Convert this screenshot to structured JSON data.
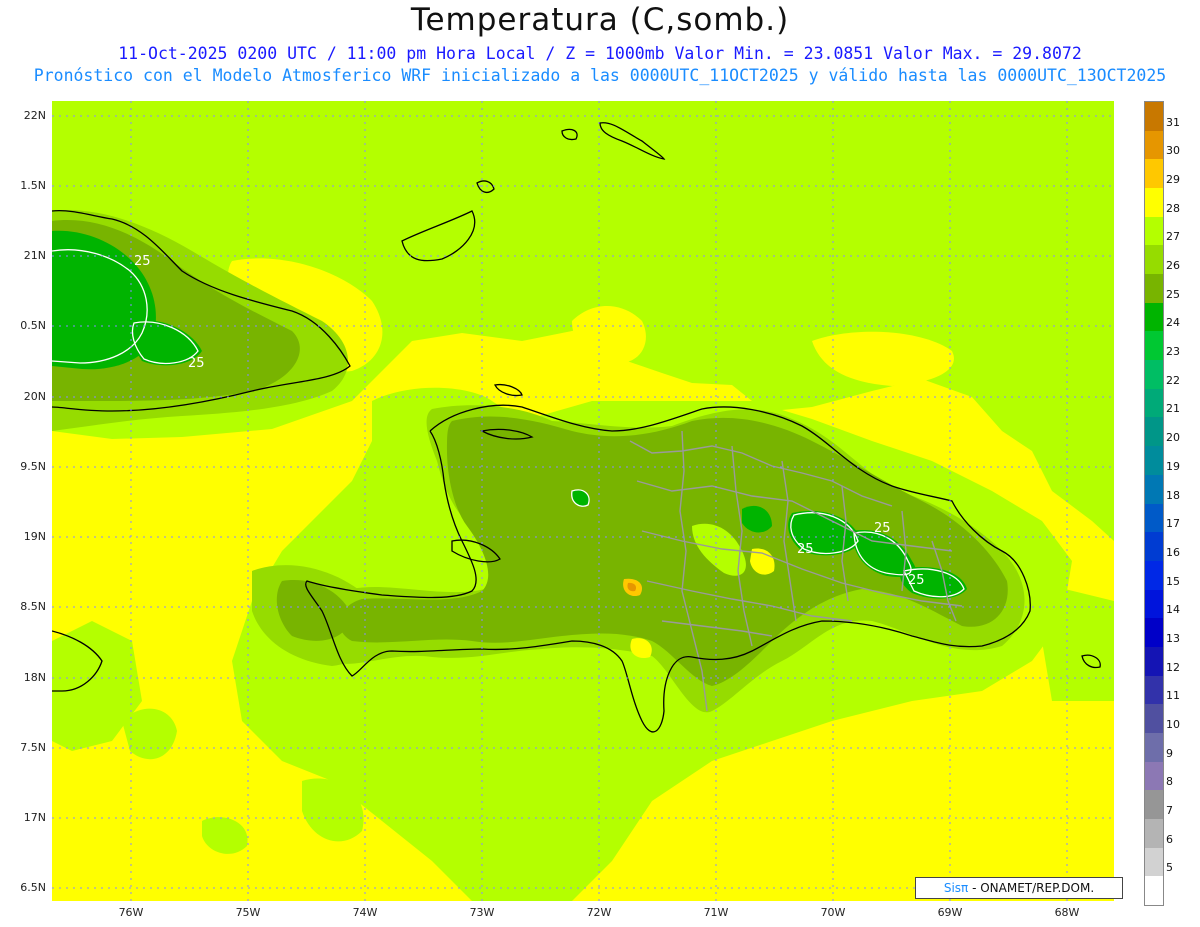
{
  "header": {
    "title": "Temperatura (C,somb.)",
    "line1": "11-Oct-2025 0200 UTC / 11:00 pm Hora Local / Z = 1000mb  Valor Min. = 23.0851  Valor Max. = 29.8072",
    "line2": "Pronóstico con el Modelo Atmosferico WRF inicializado a las 0000UTC_11OCT2025 y válido hasta las  0000UTC_13OCT2025"
  },
  "latitude_labels": [
    "22N",
    "1.5N",
    "21N",
    "0.5N",
    "20N",
    "9.5N",
    "19N",
    "8.5N",
    "18N",
    "7.5N",
    "17N",
    "6.5N"
  ],
  "longitude_labels": [
    "76W",
    "75W",
    "74W",
    "73W",
    "72W",
    "71W",
    "70W",
    "69W",
    "68W"
  ],
  "colorbar": {
    "labels": [
      "31",
      "30",
      "29",
      "28",
      "27",
      "26",
      "25",
      "24",
      "23",
      "22",
      "21",
      "20",
      "19",
      "18",
      "17",
      "16",
      "15",
      "14",
      "13",
      "12",
      "11",
      "10",
      "9",
      "8",
      "7",
      "6",
      "5"
    ],
    "colors": [
      "#c87800",
      "#e69600",
      "#ffc800",
      "#ffff00",
      "#b4ff00",
      "#96dc00",
      "#78b400",
      "#00b400",
      "#00c832",
      "#00be64",
      "#00aa78",
      "#009688",
      "#008c9c",
      "#0078b4",
      "#005ac8",
      "#003cd2",
      "#0028e6",
      "#0014dc",
      "#0000c8",
      "#1414b4",
      "#3232aa",
      "#5050a0",
      "#6e6eaa",
      "#8c78b4",
      "#969696",
      "#b4b4b4",
      "#d2d2d2",
      "#ffffff"
    ]
  },
  "contour_labels": [
    "25",
    "25",
    "25",
    "25",
    "25"
  ],
  "credit": {
    "logo": "Sisπ",
    "text": " - ONAMET/REP.DOM."
  },
  "colors": {
    "level_28_29": "#ffff00",
    "level_27_28": "#b4ff00",
    "level_26_27": "#96dc00",
    "level_25_26": "#78b400",
    "level_24_25": "#00b400",
    "coastline": "#000000",
    "provinces": "#9a9a9a",
    "gridlines": "#8888ff"
  }
}
